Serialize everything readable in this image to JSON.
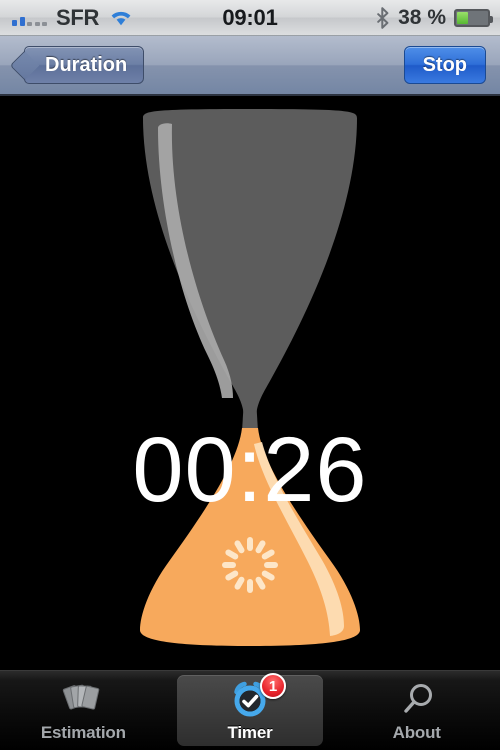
{
  "status_bar": {
    "carrier": "SFR",
    "time": "09:01",
    "battery_percent": "38 %",
    "battery_level": 38,
    "signal_bars_filled": 2,
    "signal_bars_total": 5,
    "wifi_icon": "wifi-icon",
    "bluetooth_icon": "bluetooth-icon",
    "battery_icon": "battery-icon"
  },
  "nav_bar": {
    "back_label": "Duration",
    "action_label": "Stop"
  },
  "main": {
    "timer_value": "00:26",
    "hourglass_icon": "hourglass-icon",
    "spinner_icon": "activity-spinner-icon",
    "top_bulb_color": "#5c5c5c",
    "bottom_bulb_color": "#f7a95c",
    "highlight_top_color": "#a8a8a8",
    "highlight_bottom_color": "#fdddb4"
  },
  "tab_bar": {
    "tabs": [
      {
        "label": "Estimation",
        "icon": "cards-stack-icon",
        "selected": false,
        "badge": ""
      },
      {
        "label": "Timer",
        "icon": "alarm-clock-check-icon",
        "selected": true,
        "badge": "1"
      },
      {
        "label": "About",
        "icon": "magnifier-icon",
        "selected": false,
        "badge": ""
      }
    ]
  },
  "colors": {
    "accent_blue": "#2f6fd0",
    "badge_red": "#e8242c",
    "orange": "#f7a95c",
    "background": "#000000"
  }
}
